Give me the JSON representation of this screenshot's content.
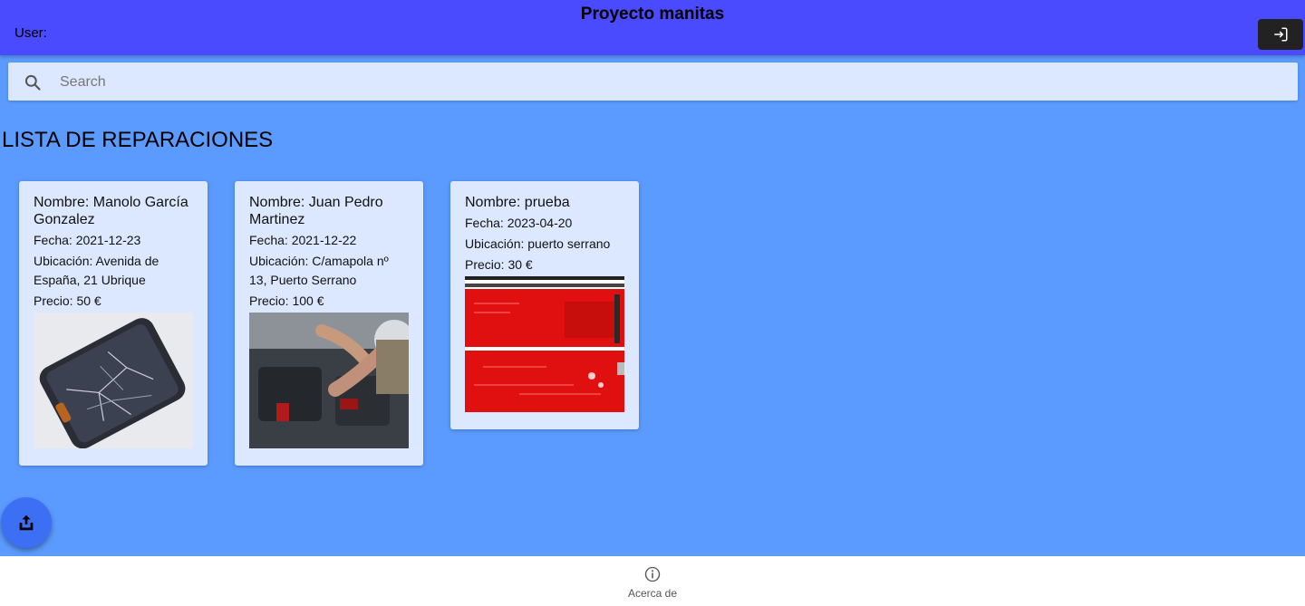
{
  "header": {
    "title": "Proyecto manitas",
    "user_label": "User:",
    "login_icon": "login-icon"
  },
  "search": {
    "placeholder": "Search",
    "value": "",
    "icon": "search-icon"
  },
  "main": {
    "section_title": "LISTA DE REPARACIONES",
    "cards": [
      {
        "name": "Nombre: Manolo García Gonzalez",
        "date": "Fecha: 2021-12-23",
        "location": "Ubicación: Avenida de España, 21 Ubrique",
        "price": "Precio: 50 €",
        "image": "cracked-phone-photo"
      },
      {
        "name": "Nombre: Juan Pedro Martinez",
        "date": "Fecha: 2021-12-22",
        "location": "Ubicación: C/amapola nº 13, Puerto Serrano",
        "price": "Precio: 100 €",
        "image": "car-engine-repair-photo"
      },
      {
        "name": "Nombre: prueba",
        "date": "Fecha: 2023-04-20",
        "location": "Ubicación: puerto serrano",
        "price": "Precio: 30 €",
        "image": "red-circuit-board-photo"
      }
    ]
  },
  "fab": {
    "icon": "share-icon"
  },
  "tabbar": {
    "about_label": "Acerca de",
    "about_icon": "info-icon"
  },
  "colors": {
    "header_bg": "#4a4aff",
    "page_bg": "#5b9bff",
    "card_bg": "#dce8ff",
    "fab_bg": "#3d6ff5"
  }
}
